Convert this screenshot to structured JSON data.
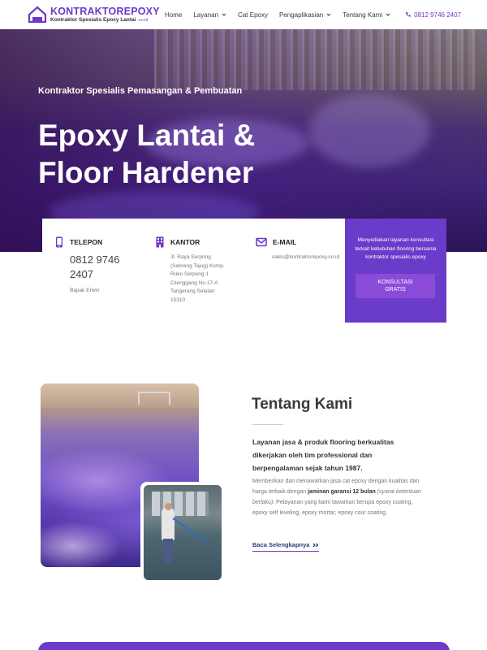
{
  "brand": {
    "name": "KONTRAKTOREPOXY",
    "tagline": "Kontraktor Spesialis Epoxy Lantai",
    "domain_suffix": ".co.id",
    "accent": "#6b3bc9"
  },
  "nav": {
    "items": [
      {
        "label": "Home",
        "dropdown": false
      },
      {
        "label": "Layanan",
        "dropdown": true
      },
      {
        "label": "Cat Epoxy",
        "dropdown": false
      },
      {
        "label": "Pengaplikasian",
        "dropdown": true
      },
      {
        "label": "Tentang Kami",
        "dropdown": true
      }
    ],
    "phone": "0812 9746 2407"
  },
  "hero": {
    "kicker": "Kontraktor Spesialis Pemasangan & Pembuatan",
    "title_line1": "Epoxy Lantai &",
    "title_line2": "Floor Hardener"
  },
  "info": {
    "telepon": {
      "label": "TELEPON",
      "value": "0812 9746 2407",
      "person": "Bapak Erwin"
    },
    "kantor": {
      "label": "KANTOR",
      "address": [
        "Jl. Raya Serpong",
        "(Sebrang Tajug) Komp.",
        "Ruko Serpong 1",
        "Cilenggang No.17-A",
        "Tangerang Selatan",
        "15310"
      ]
    },
    "email": {
      "label": "E-MAIL",
      "value": "sales@kontraktorepoxy.co.id"
    },
    "cta": {
      "text": "Menyediakan layanan konsultasi terkait kebutuhan flooring bersama kontraktor spesialis epoxy",
      "button_line1": "KONSULTASI",
      "button_line2": "GRATIS"
    }
  },
  "about": {
    "title": "Tentang Kami",
    "lead": "Layanan jasa & produk flooring berkualitas dikerjakan oleh tim professional dan berpengalaman sejak tahun 1987.",
    "body_part1": "Memberikan dan menawarkan jasa cat epoxy dengan kualitas dan harga terbaik dengan ",
    "body_bold": "jaminan garansi 12 bulan",
    "body_italic": " (syarat ketentuan berlaku)",
    "body_part2": ". Pelayanan yang kami tawarkan berupa epoxy coating, epoxy self leveling, epoxy mortar, epoxy cour coating.",
    "read_more": "Baca Selengkapnya"
  }
}
